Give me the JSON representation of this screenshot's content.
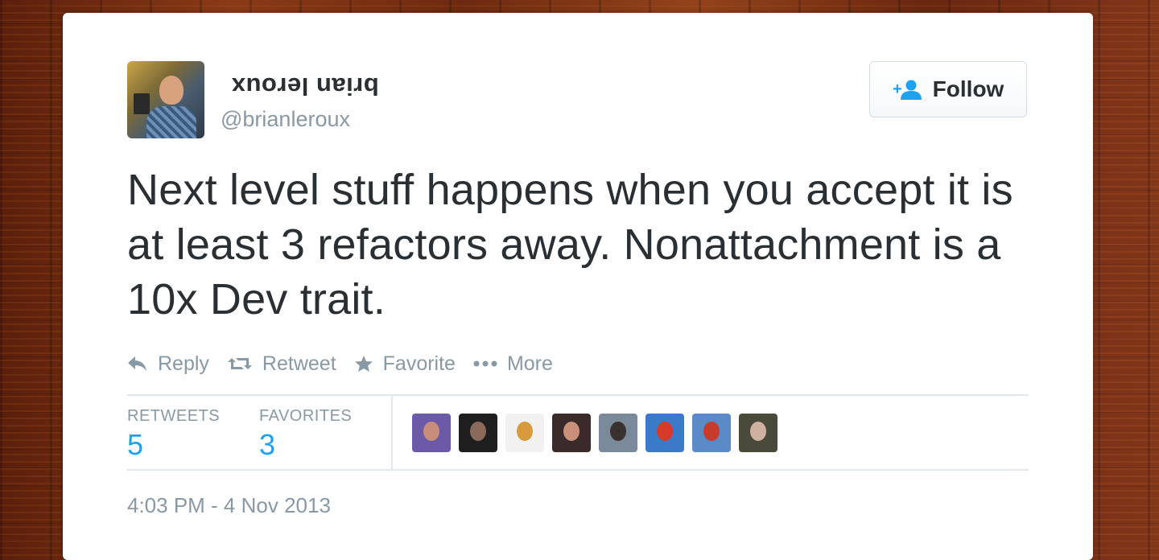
{
  "user": {
    "display_name": "brian leroux",
    "handle": "@brianleroux"
  },
  "follow_button": {
    "label": "Follow",
    "icon": "add-user-icon"
  },
  "tweet": {
    "text": "Next level stuff happens when you accept it is at least 3 refactors away. Nonattachment is a 10x Dev trait."
  },
  "actions": [
    {
      "label": "Reply",
      "icon": "reply-icon"
    },
    {
      "label": "Retweet",
      "icon": "retweet-icon"
    },
    {
      "label": "Favorite",
      "icon": "star-icon"
    },
    {
      "label": "More",
      "icon": "more-dots-icon"
    }
  ],
  "stats": {
    "retweets_label": "RETWEETS",
    "retweets_count": "5",
    "favorites_label": "FAVORITES",
    "favorites_count": "3"
  },
  "favoriters": [
    {
      "bg": "#6b5aa8",
      "head": "#c98e7a"
    },
    {
      "bg": "#1e1e1e",
      "head": "#8a6a5a"
    },
    {
      "bg": "#f1f1f1",
      "head": "#d89a3a"
    },
    {
      "bg": "#3a2a2a",
      "head": "#c9907a"
    },
    {
      "bg": "#7a8a9a",
      "head": "#3a3030"
    },
    {
      "bg": "#3a7ac8",
      "head": "#d83a2a"
    },
    {
      "bg": "#5a8ac8",
      "head": "#c83a2a"
    },
    {
      "bg": "#4a4a3a",
      "head": "#d0b0a0"
    }
  ],
  "timestamp": "4:03 PM - 4 Nov 2013",
  "colors": {
    "accent": "#1da1f2",
    "text": "#292f33",
    "muted": "#8899a6"
  }
}
